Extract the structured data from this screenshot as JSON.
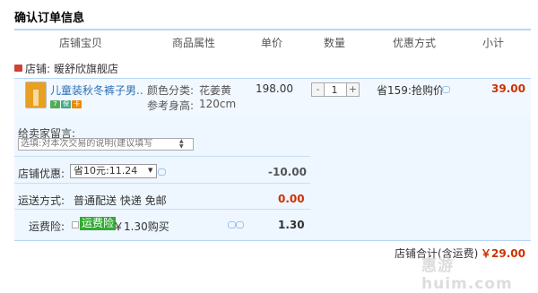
{
  "page_title": "确认订单信息",
  "headers": [
    "店铺宝贝",
    "商品属性",
    "单价",
    "数量",
    "优惠方式",
    "小计"
  ],
  "store": {
    "label": "店铺:",
    "name": "暖舒欣旗舰店"
  },
  "item": {
    "name": "儿童装秋冬裤子男...",
    "badges": [
      "7",
      "保",
      "卡"
    ],
    "attr_color_label": "颜色分类:",
    "attr_color_value": "花姜黄",
    "attr_height_label": "参考身高:",
    "attr_height_value": "120cm",
    "price": "198.00",
    "qty_minus": "-",
    "qty_value": "1",
    "qty_plus": "+",
    "promo": "省159:抢购价",
    "subtotal": "39.00"
  },
  "message": {
    "label": "给卖家留言:",
    "placeholder": "选填:对本次交易的说明(建议填写"
  },
  "discount": {
    "label": "店铺优惠:",
    "selected": "省10元:11.24",
    "value": "-10.00"
  },
  "shipping": {
    "label": "运送方式:",
    "value": "普通配送 快递 免邮",
    "fee": "0.00"
  },
  "insurance": {
    "label": "运费险:",
    "tag": "运费险",
    "price": "￥1.30购买",
    "value": "1.30"
  },
  "total": {
    "label": "店铺合计(含运费)",
    "amount": "￥29.00"
  },
  "watermark": "惠游 huim.com",
  "colors": {
    "accent_blue": "#b8d6f5",
    "price_red": "#cc3300",
    "panel_bg": "#eef6ff",
    "ins_green": "#33aa33"
  }
}
